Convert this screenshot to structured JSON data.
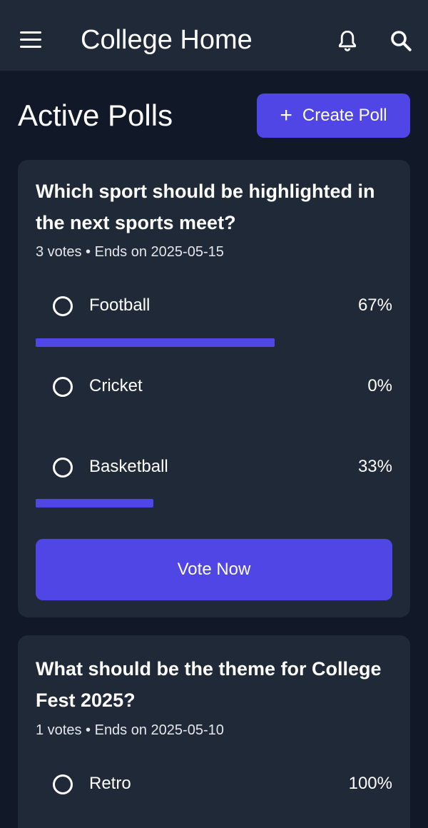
{
  "colors": {
    "background": "#111827",
    "card": "#1f2937",
    "accent": "#4f46e5"
  },
  "appbar": {
    "menu_icon": "hamburger-menu-icon",
    "title": "College Home",
    "notification_icon": "bell-icon",
    "search_icon": "search-icon"
  },
  "page": {
    "title": "Active Polls",
    "create_button": {
      "icon": "plus-icon",
      "label": "Create Poll"
    }
  },
  "polls": [
    {
      "question": "Which sport should be highlighted in the next sports meet?",
      "meta": "3 votes • Ends on 2025-05-15",
      "options": [
        {
          "label": "Football",
          "percent_text": "67%",
          "fraction": 0.67
        },
        {
          "label": "Cricket",
          "percent_text": "0%",
          "fraction": 0
        },
        {
          "label": "Basketball",
          "percent_text": "33%",
          "fraction": 0.33
        }
      ],
      "vote_button": "Vote Now"
    },
    {
      "question": "What should be the theme for College Fest 2025?",
      "meta": "1 votes • Ends on 2025-05-10",
      "options": [
        {
          "label": "Retro",
          "percent_text": "100%",
          "fraction": 1
        }
      ]
    }
  ]
}
